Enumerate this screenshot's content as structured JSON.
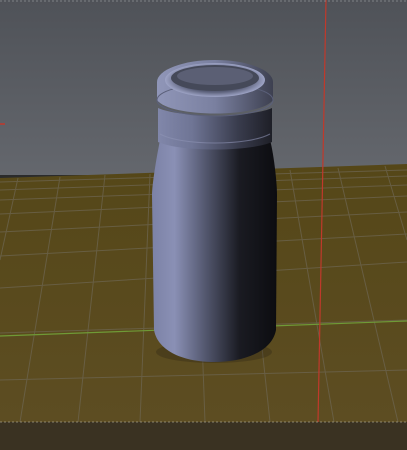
{
  "viewport": {
    "sky_color": "#5a5d63",
    "floor_color": "#5a4a1f",
    "grid_color": "#6b6a55",
    "x_axis_color": "#7a9a3a",
    "y_axis_color": "#c23a3a",
    "object_color": "#6e7391",
    "bottom_bar_color": "#3a3222"
  },
  "objects": [
    {
      "name": "bottle"
    }
  ]
}
